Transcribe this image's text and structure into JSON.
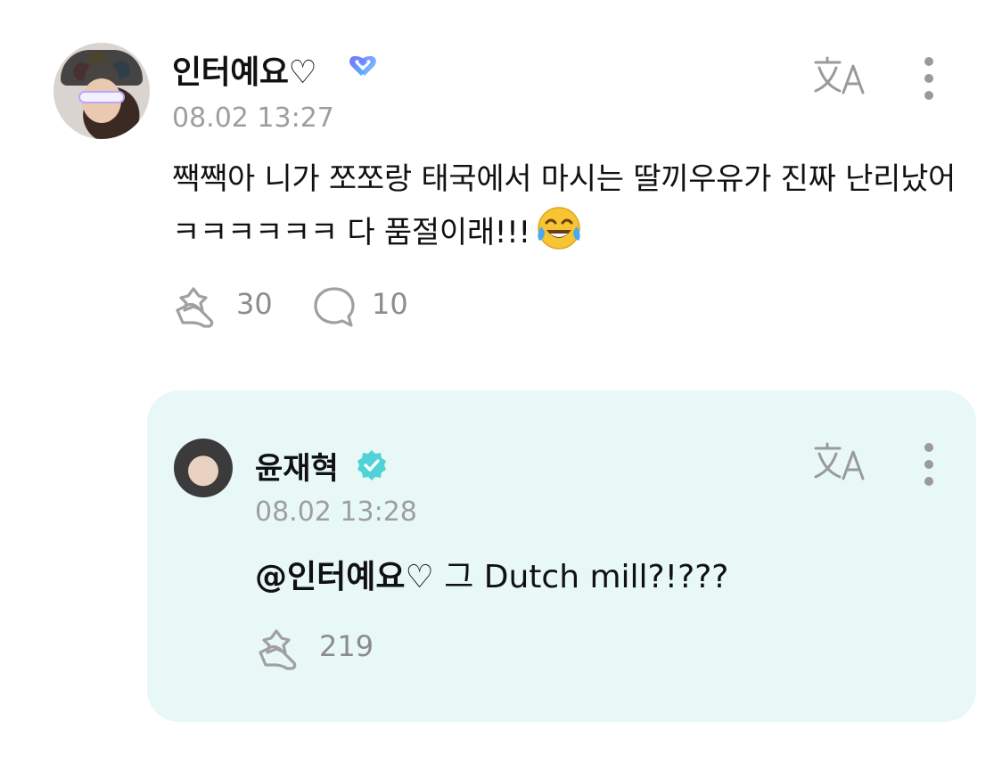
{
  "comment": {
    "author": "인터예요♡",
    "badge_icon": "double-heart-badge-icon",
    "timestamp": "08.02 13:27",
    "text": "짹짹아 니가 쪼쪼랑 태국에서 마시는 딸끼우유가 진짜 난리났어 ㅋㅋㅋㅋㅋㅋ 다 품절이래!!!",
    "emoji": "face-with-tears-of-joy",
    "like_count": "30",
    "reply_count": "10",
    "actions": {
      "translate_icon": "translate-icon",
      "more_icon": "more-vertical-icon"
    }
  },
  "reply": {
    "author": "윤재혁",
    "badge_icon": "verified-badge-icon",
    "timestamp": "08.02 13:28",
    "mention": "@인터예요♡",
    "text": " 그 Dutch mill?!???",
    "like_count": "219",
    "actions": {
      "translate_icon": "translate-icon",
      "more_icon": "more-vertical-icon"
    }
  },
  "colors": {
    "reply_background": "#e8f8f6",
    "muted_text": "#9e9e9e",
    "verified_badge": "#4fd3d6",
    "icon_gray": "#a0a0a0"
  }
}
